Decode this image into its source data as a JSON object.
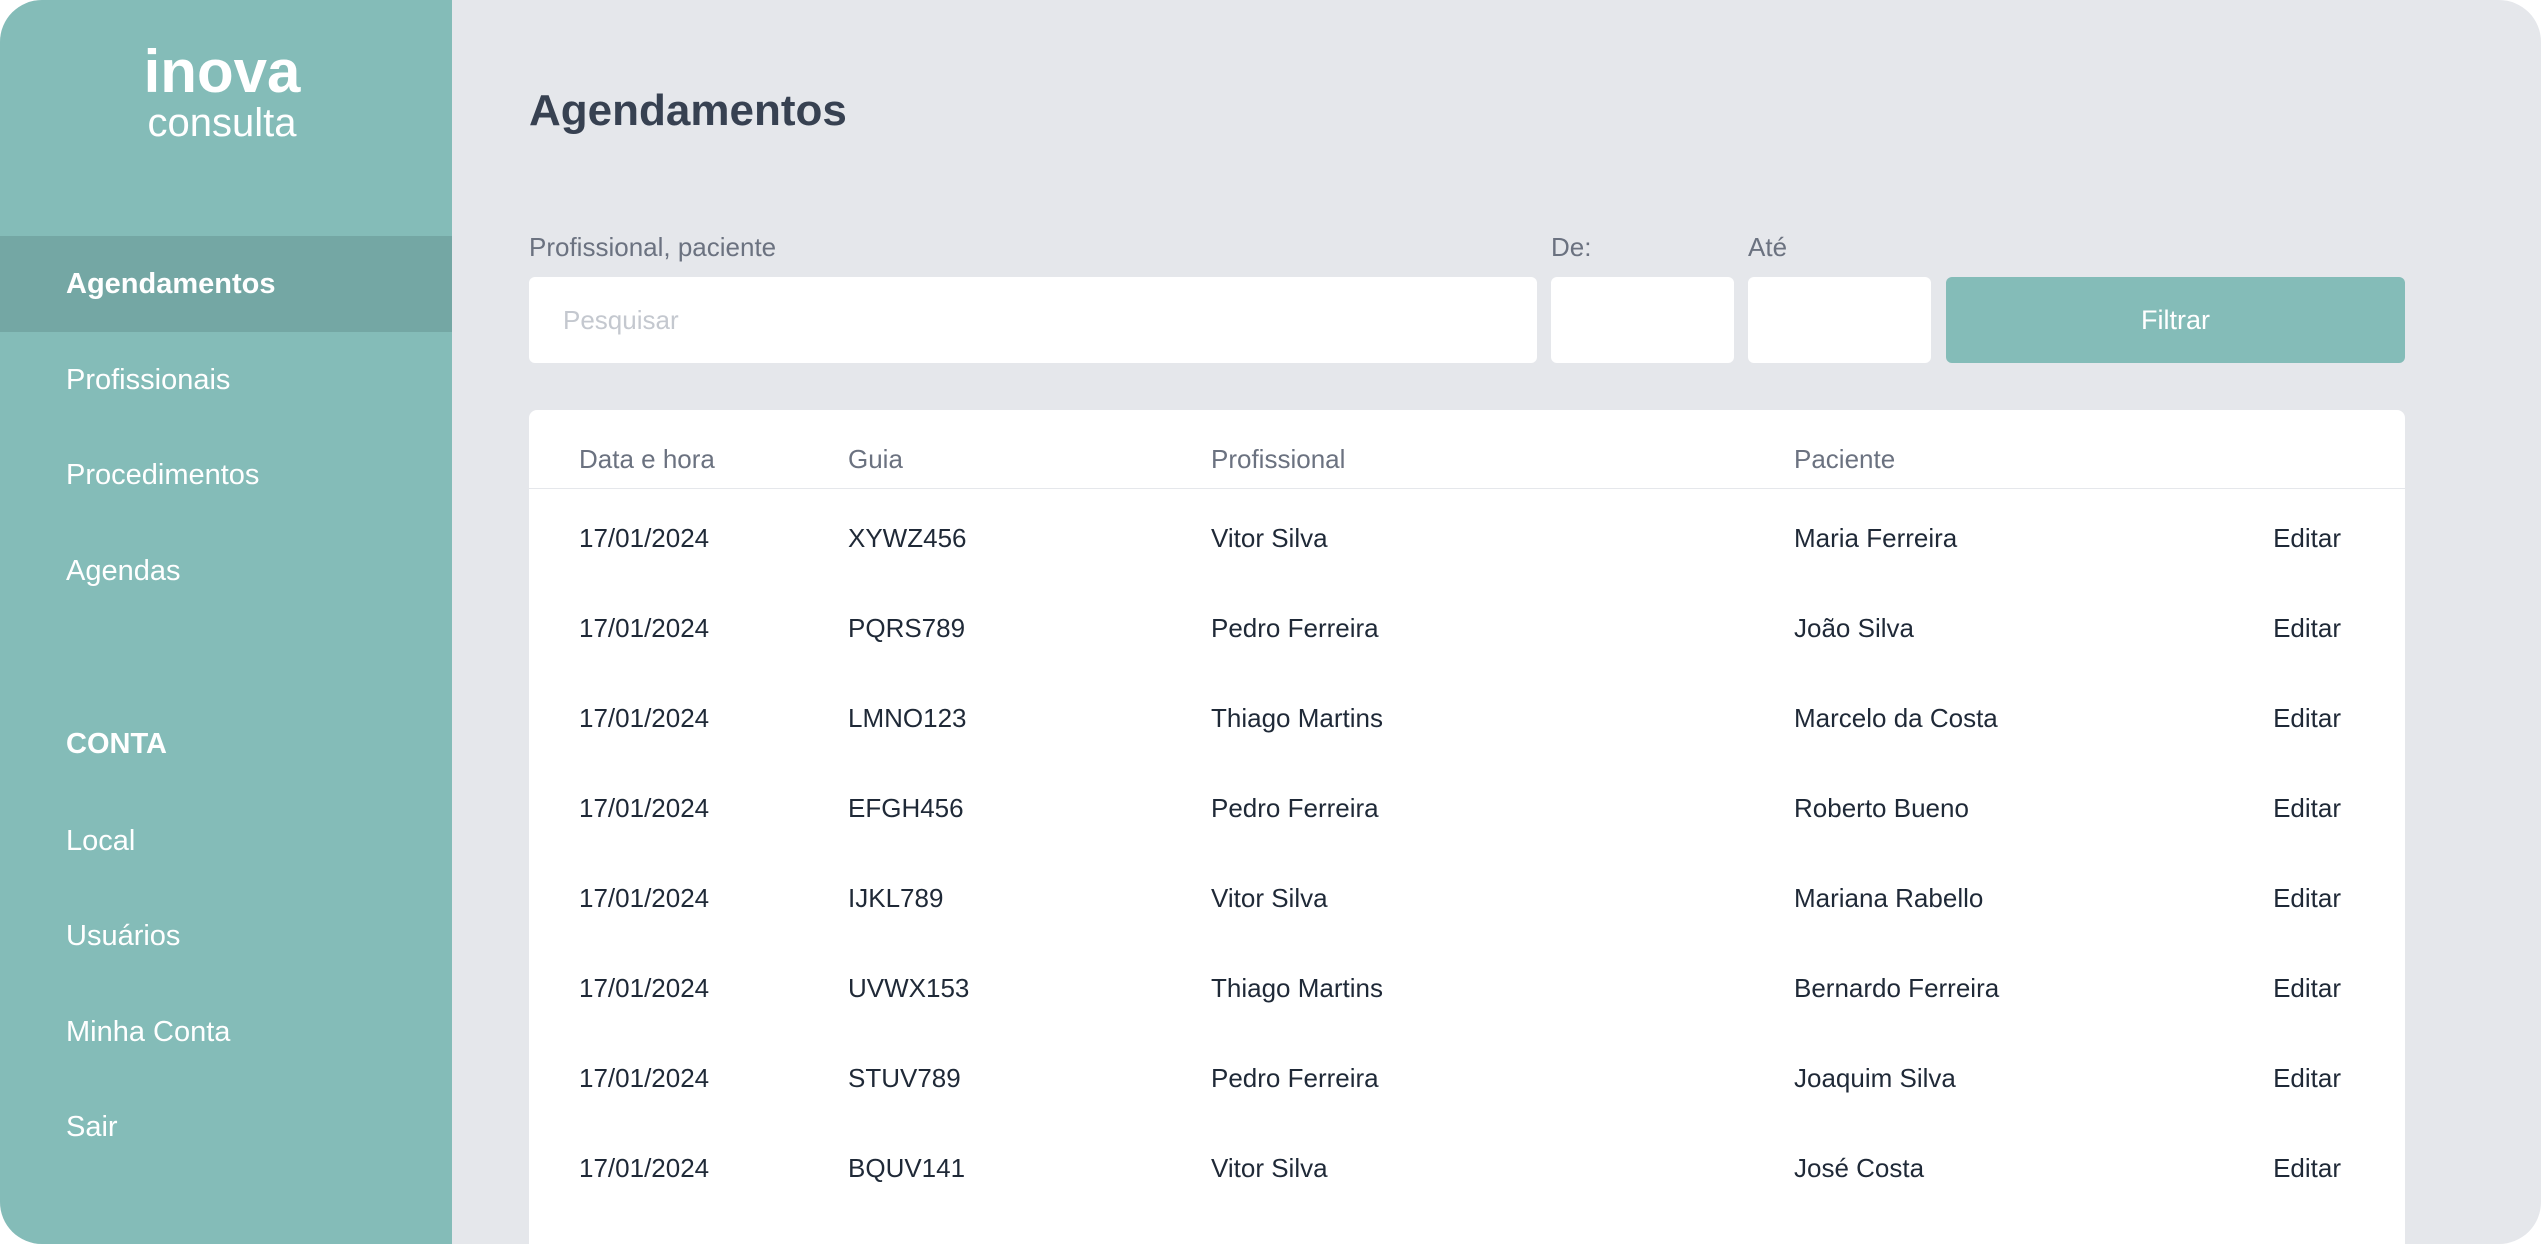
{
  "brand": {
    "logo_top": "inova",
    "logo_bottom": "consulta"
  },
  "sidebar": {
    "items": [
      {
        "label": "Agendamentos",
        "active": true
      },
      {
        "label": "Profissionais",
        "active": false
      },
      {
        "label": "Procedimentos",
        "active": false
      },
      {
        "label": "Agendas",
        "active": false
      }
    ],
    "section_title": "CONTA",
    "account_items": [
      {
        "label": "Local"
      },
      {
        "label": "Usuários"
      },
      {
        "label": "Minha Conta"
      },
      {
        "label": "Sair"
      }
    ]
  },
  "main": {
    "title": "Agendamentos",
    "filters": {
      "search_label": "Profissional, paciente",
      "search_placeholder": "Pesquisar",
      "search_value": "",
      "from_label": "De:",
      "from_value": "",
      "to_label": "Até",
      "to_value": "",
      "button_label": "Filtrar"
    },
    "table": {
      "columns": [
        "Data e hora",
        "Guia",
        "Profissional",
        "Paciente"
      ],
      "edit_label": "Editar",
      "rows": [
        {
          "date": "17/01/2024",
          "guide": "XYWZ456",
          "professional": "Vitor Silva",
          "patient": "Maria Ferreira"
        },
        {
          "date": "17/01/2024",
          "guide": "PQRS789",
          "professional": "Pedro Ferreira",
          "patient": "João Silva"
        },
        {
          "date": "17/01/2024",
          "guide": "LMNO123",
          "professional": "Thiago Martins",
          "patient": "Marcelo da Costa"
        },
        {
          "date": "17/01/2024",
          "guide": "EFGH456",
          "professional": "Pedro Ferreira",
          "patient": "Roberto Bueno"
        },
        {
          "date": "17/01/2024",
          "guide": "IJKL789",
          "professional": "Vitor Silva",
          "patient": "Mariana Rabello"
        },
        {
          "date": "17/01/2024",
          "guide": "UVWX153",
          "professional": "Thiago Martins",
          "patient": "Bernardo Ferreira"
        },
        {
          "date": "17/01/2024",
          "guide": "STUV789",
          "professional": "Pedro Ferreira",
          "patient": "Joaquim Silva"
        },
        {
          "date": "17/01/2024",
          "guide": "BQUV141",
          "professional": "Vitor Silva",
          "patient": "José Costa"
        }
      ]
    }
  },
  "colors": {
    "sidebar": "#84bcb8",
    "sidebar_active": "#74a7a4",
    "background": "#e5e7eb",
    "button": "#84bcb8"
  }
}
